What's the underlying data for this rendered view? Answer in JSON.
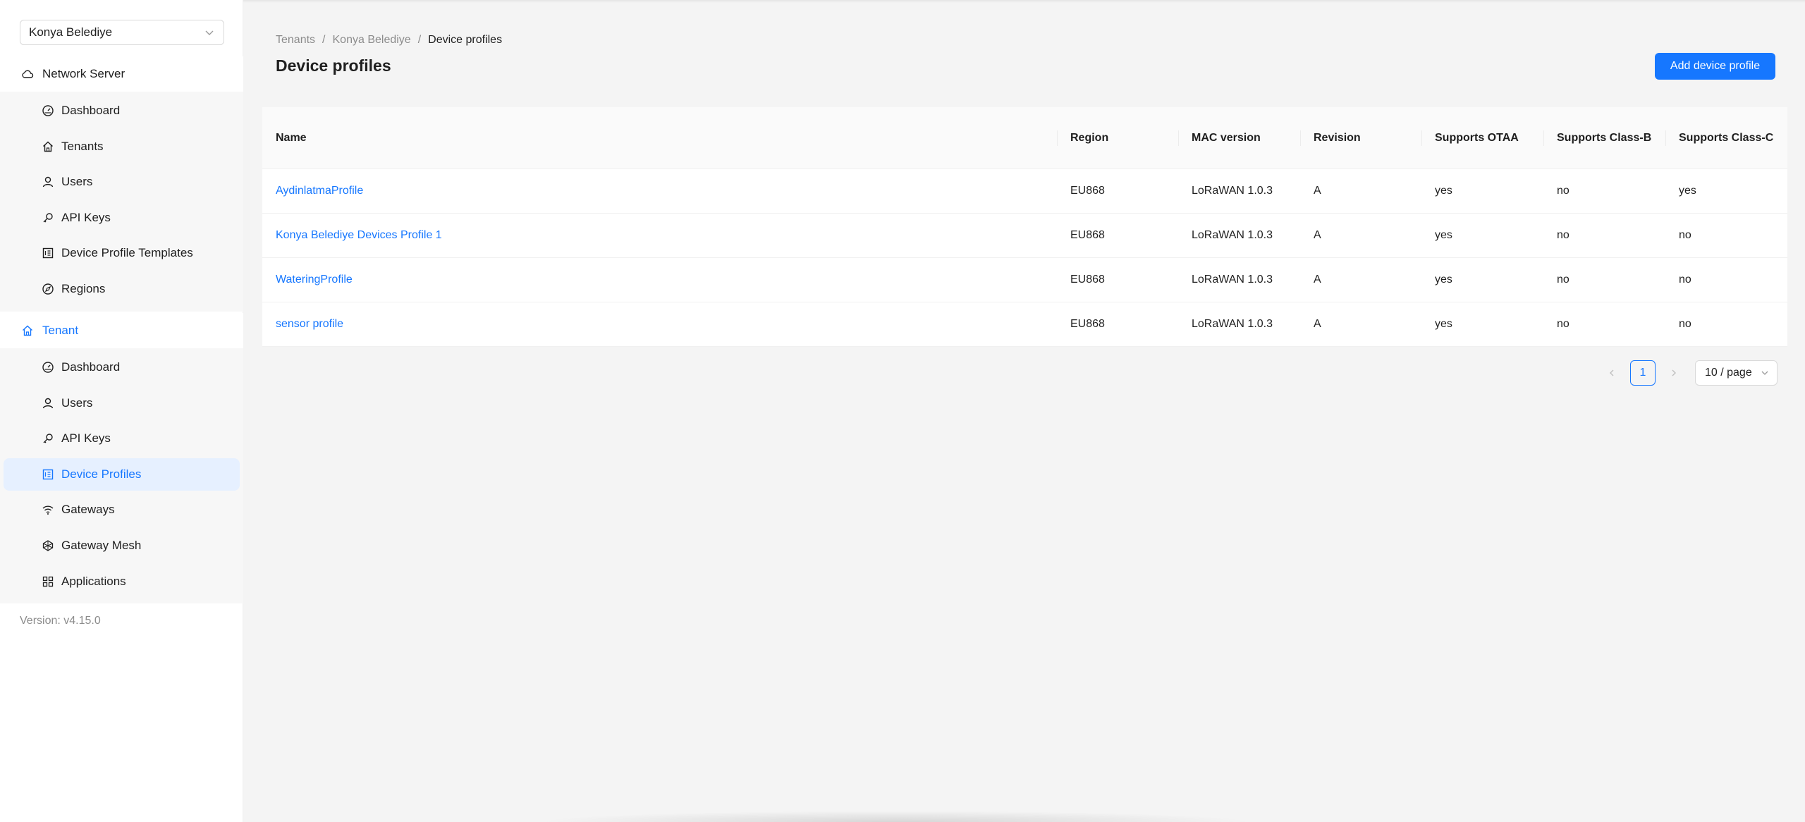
{
  "sidebar": {
    "tenant_select": "Konya Belediye",
    "network_server": {
      "label": "Network Server",
      "items": [
        {
          "label": "Dashboard",
          "icon": "dashboard-icon"
        },
        {
          "label": "Tenants",
          "icon": "home-icon"
        },
        {
          "label": "Users",
          "icon": "user-icon"
        },
        {
          "label": "API Keys",
          "icon": "key-icon"
        },
        {
          "label": "Device Profile Templates",
          "icon": "profile-icon"
        },
        {
          "label": "Regions",
          "icon": "compass-icon"
        }
      ]
    },
    "tenant": {
      "label": "Tenant",
      "items": [
        {
          "label": "Dashboard",
          "icon": "dashboard-icon"
        },
        {
          "label": "Users",
          "icon": "user-icon"
        },
        {
          "label": "API Keys",
          "icon": "key-icon"
        },
        {
          "label": "Device Profiles",
          "icon": "profile-icon",
          "active": true
        },
        {
          "label": "Gateways",
          "icon": "wifi-icon"
        },
        {
          "label": "Gateway Mesh",
          "icon": "mesh-icon"
        },
        {
          "label": "Applications",
          "icon": "appstore-icon"
        }
      ]
    },
    "version": "Version: v4.15.0"
  },
  "breadcrumb": {
    "items": [
      "Tenants",
      "Konya Belediye",
      "Device profiles"
    ],
    "separator": "/"
  },
  "page": {
    "title": "Device profiles",
    "add_button": "Add device profile"
  },
  "table": {
    "columns": [
      "Name",
      "Region",
      "MAC version",
      "Revision",
      "Supports OTAA",
      "Supports Class-B",
      "Supports Class-C"
    ],
    "rows": [
      [
        "AydinlatmaProfile",
        "EU868",
        "LoRaWAN 1.0.3",
        "A",
        "yes",
        "no",
        "yes"
      ],
      [
        "Konya Belediye Devices Profile 1",
        "EU868",
        "LoRaWAN 1.0.3",
        "A",
        "yes",
        "no",
        "no"
      ],
      [
        "WateringProfile",
        "EU868",
        "LoRaWAN 1.0.3",
        "A",
        "yes",
        "no",
        "no"
      ],
      [
        "sensor profile",
        "EU868",
        "LoRaWAN 1.0.3",
        "A",
        "yes",
        "no",
        "no"
      ]
    ]
  },
  "pagination": {
    "current_page": "1",
    "page_size": "10 / page"
  },
  "colors": {
    "accent": "#1677ff",
    "active_bg": "#e6f0ff"
  }
}
